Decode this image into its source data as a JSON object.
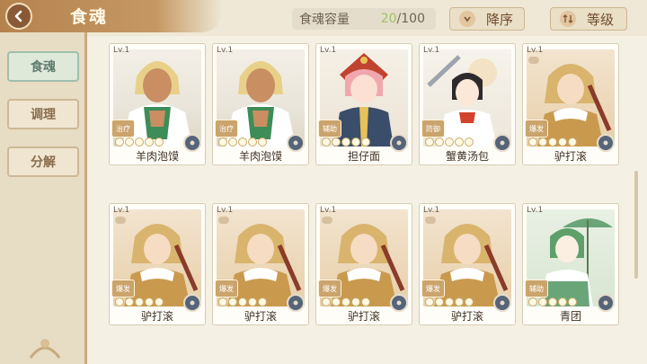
{
  "header": {
    "title": "食魂",
    "capacity_label": "食魂容量",
    "capacity_current": "20",
    "capacity_max": "/100",
    "sort_order": "降序",
    "sort_key": "等级"
  },
  "sidebar": {
    "tabs": [
      {
        "label": "食魂",
        "active": true
      },
      {
        "label": "调理",
        "active": false
      },
      {
        "label": "分解",
        "active": false
      }
    ]
  },
  "cards": [
    {
      "level": "Lv.1",
      "name": "羊肉泡馍",
      "role": "治疗",
      "theme": "green-white",
      "heart": false
    },
    {
      "level": "Lv.1",
      "name": "羊肉泡馍",
      "role": "治疗",
      "theme": "green-white",
      "heart": false
    },
    {
      "level": "Lv.1",
      "name": "担仔面",
      "role": "辅助",
      "theme": "pink-hat",
      "heart": false
    },
    {
      "level": "Lv.1",
      "name": "蟹黄汤包",
      "role": "防御",
      "theme": "white-red",
      "heart": false
    },
    {
      "level": "Lv.1",
      "name": "驴打滚",
      "role": "爆发",
      "theme": "gold-orange",
      "heart": true
    },
    {
      "level": "Lv.1",
      "name": "驴打滚",
      "role": "爆发",
      "theme": "gold-orange",
      "heart": true
    },
    {
      "level": "Lv.1",
      "name": "驴打滚",
      "role": "爆发",
      "theme": "gold-orange",
      "heart": true
    },
    {
      "level": "Lv.1",
      "name": "驴打滚",
      "role": "爆发",
      "theme": "gold-orange",
      "heart": true
    },
    {
      "level": "Lv.1",
      "name": "驴打滚",
      "role": "爆发",
      "theme": "gold-orange",
      "heart": true
    },
    {
      "level": "Lv.1",
      "name": "青团",
      "role": "辅助",
      "theme": "green-umbrella",
      "heart": false
    }
  ],
  "colors": {
    "accent": "#c59863",
    "capacity_current": "#9dc26a",
    "active_tab": "#9fbfad"
  }
}
